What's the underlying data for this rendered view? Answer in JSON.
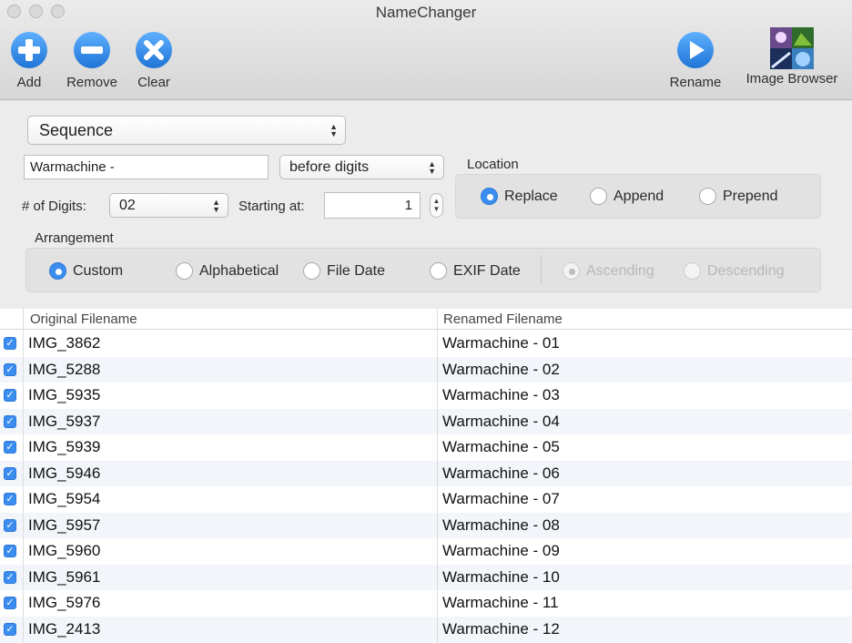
{
  "window": {
    "title": "NameChanger"
  },
  "toolbar": {
    "add_label": "Add",
    "remove_label": "Remove",
    "clear_label": "Clear",
    "rename_label": "Rename",
    "image_browser_label": "Image Browser"
  },
  "options": {
    "mode": "Sequence",
    "text": "Warmachine -",
    "position": "before digits",
    "digits_label": "# of Digits:",
    "digits": "02",
    "starting_label": "Starting at:",
    "starting": "1",
    "location": {
      "label": "Location",
      "options": [
        "Replace",
        "Append",
        "Prepend"
      ],
      "selected": "Replace"
    },
    "arrangement": {
      "label": "Arrangement",
      "options": [
        "Custom",
        "Alphabetical",
        "File Date",
        "EXIF Date"
      ],
      "selected": "Custom",
      "order_options": [
        "Ascending",
        "Descending"
      ],
      "order_selected": "Ascending"
    }
  },
  "table": {
    "columns": [
      "Original Filename",
      "Renamed Filename"
    ],
    "rows": [
      {
        "checked": true,
        "original": "IMG_3862",
        "renamed": "Warmachine - 01"
      },
      {
        "checked": true,
        "original": "IMG_5288",
        "renamed": "Warmachine - 02"
      },
      {
        "checked": true,
        "original": "IMG_5935",
        "renamed": "Warmachine - 03"
      },
      {
        "checked": true,
        "original": "IMG_5937",
        "renamed": "Warmachine - 04"
      },
      {
        "checked": true,
        "original": "IMG_5939",
        "renamed": "Warmachine - 05"
      },
      {
        "checked": true,
        "original": "IMG_5946",
        "renamed": "Warmachine - 06"
      },
      {
        "checked": true,
        "original": "IMG_5954",
        "renamed": "Warmachine - 07"
      },
      {
        "checked": true,
        "original": "IMG_5957",
        "renamed": "Warmachine - 08"
      },
      {
        "checked": true,
        "original": "IMG_5960",
        "renamed": "Warmachine - 09"
      },
      {
        "checked": true,
        "original": "IMG_5961",
        "renamed": "Warmachine - 10"
      },
      {
        "checked": true,
        "original": "IMG_5976",
        "renamed": "Warmachine - 11"
      },
      {
        "checked": true,
        "original": "IMG_2413",
        "renamed": "Warmachine - 12"
      }
    ]
  },
  "colors": {
    "accent": "#3b8ef0",
    "toolbar_icon": "#2f86e0",
    "row_alt": "#f2f5f9"
  },
  "icons": [
    "add-icon",
    "remove-icon",
    "clear-icon",
    "rename-icon",
    "image-browser-icon",
    "chevron-updown-icon",
    "checkmark-icon"
  ]
}
